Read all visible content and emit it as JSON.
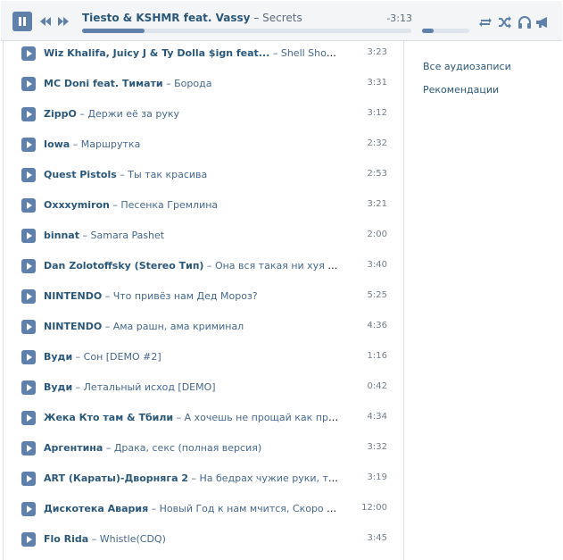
{
  "player": {
    "artist": "Tiesto & KSHMR feat. Vassy",
    "dash": " – ",
    "title": "Secrets",
    "time_remaining": "-3:13",
    "progress": 0.19,
    "volume": 0.25,
    "icons": [
      "pause-icon",
      "prev-icon",
      "next-icon",
      "repeat-icon",
      "shuffle-icon",
      "headphones-icon",
      "broadcast-icon"
    ],
    "accent_color": "#5e80aa"
  },
  "tracks": [
    {
      "artist": "Wiz Khalifa, Juicy J & Ty Dolla $ign feat...",
      "title": "Shell Shocked",
      "duration": "3:23"
    },
    {
      "artist": "MC Doni feat. Тимати",
      "title": "Борода",
      "duration": "3:31"
    },
    {
      "artist": "ZippO",
      "title": "Держи её за руку",
      "duration": "3:12"
    },
    {
      "artist": "Iowa",
      "title": "Маршрутка",
      "duration": "2:32"
    },
    {
      "artist": "Quest Pistols",
      "title": "Ты так красива",
      "duration": "2:53"
    },
    {
      "artist": "Oxxxymiron",
      "title": "Песенка Гремлина",
      "duration": "3:21"
    },
    {
      "artist": "binnat",
      "title": "Samara Pashet",
      "duration": "2:00"
    },
    {
      "artist": "Dan Zolotoffsky (Stereo Тип)",
      "title": "Она вся такая ни хуя себе ц...",
      "duration": "3:40"
    },
    {
      "artist": "NINTENDO",
      "title": "Что привёз нам Дед Мороз?",
      "duration": "5:25"
    },
    {
      "artist": "NINTENDO",
      "title": "Ама рашн, ама криминал",
      "duration": "4:36"
    },
    {
      "artist": "Вуди",
      "title": "Сон [DEMO #2]",
      "duration": "1:16"
    },
    {
      "artist": "Вуди",
      "title": "Летальный исход [DEMO]",
      "duration": "0:42"
    },
    {
      "artist": "Жека Кто там & Тбили",
      "title": "А хочешь не прощай как прежде, н...",
      "duration": "4:34"
    },
    {
      "artist": "Аргентина",
      "title": "Драка, секс (полная версия)",
      "duration": "3:32"
    },
    {
      "artist": "ART (Караты)-Дворняга 2",
      "title": "На бедрах чужие руки, ты хуже...",
      "duration": "3:19"
    },
    {
      "artist": "Дискотека Авария",
      "title": "Новый Год к нам мчится, Скоро все слу...",
      "duration": "12:00"
    },
    {
      "artist": "Flo Rida",
      "title": "Whistle(CDQ)",
      "duration": "3:45"
    }
  ],
  "sidebar": {
    "all_audio": "Все аудиозаписи",
    "recommendations": "Рекомендации"
  }
}
